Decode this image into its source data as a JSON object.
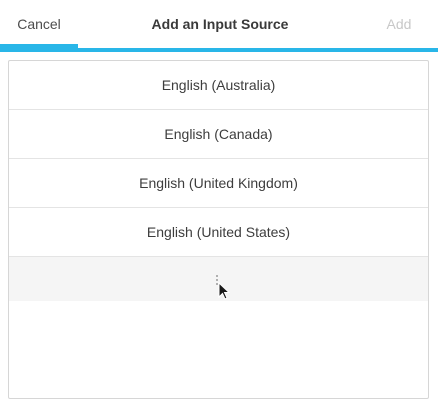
{
  "header": {
    "cancel_label": "Cancel",
    "title": "Add an Input Source",
    "add_label": "Add",
    "accent_color": "#29b6e8"
  },
  "list": {
    "items": [
      {
        "label": "English (Australia)"
      },
      {
        "label": "English (Canada)"
      },
      {
        "label": "English (United Kingdom)"
      },
      {
        "label": "English (United States)"
      }
    ],
    "more_icon": "vertical-ellipsis-icon"
  },
  "pointer": {
    "icon": "mouse-pointer-icon"
  }
}
